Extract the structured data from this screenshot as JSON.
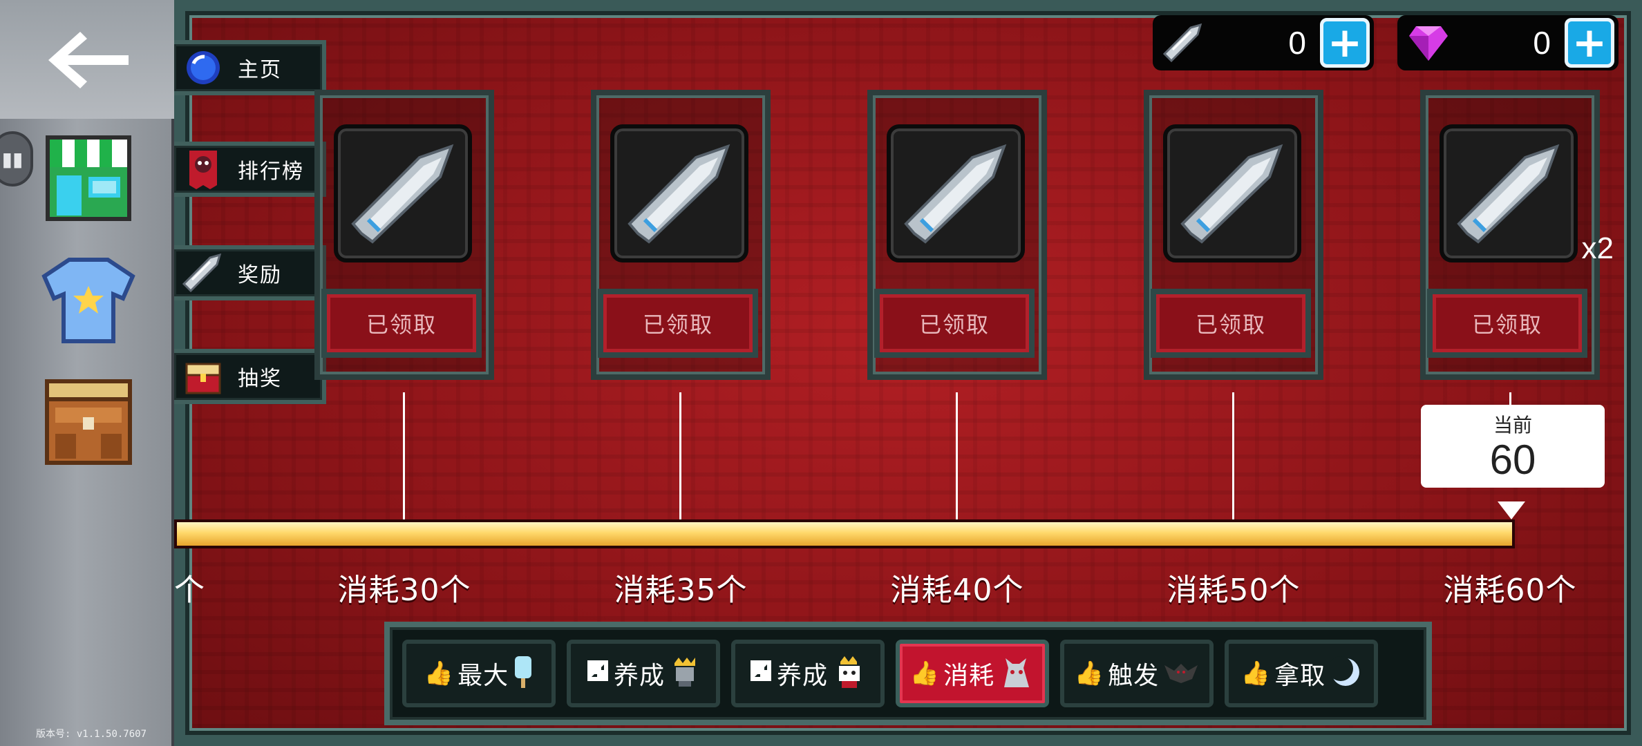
{
  "app": {
    "version_label": "版本号:",
    "version": "v1.1.50.7607"
  },
  "side_menu": [
    {
      "label": "主页",
      "icon": "blue-orb-icon"
    },
    {
      "label": "排行榜",
      "icon": "demon-banner-icon"
    },
    {
      "label": "奖励",
      "icon": "bullet-icon"
    },
    {
      "label": "抽奖",
      "icon": "treasure-chest-icon"
    }
  ],
  "sidebar": {
    "side_tab_glyph": "▮▮"
  },
  "currency": {
    "bullets": {
      "value": "0",
      "icon": "bullet-icon"
    },
    "gems": {
      "value": "0",
      "icon": "gem-icon"
    },
    "plus": "+"
  },
  "rewards": [
    {
      "milestone": "消耗30个",
      "status": "已领取",
      "qty": ""
    },
    {
      "milestone": "消耗35个",
      "status": "已领取",
      "qty": ""
    },
    {
      "milestone": "消耗40个",
      "status": "已领取",
      "qty": ""
    },
    {
      "milestone": "消耗50个",
      "status": "已领取",
      "qty": ""
    },
    {
      "milestone": "消耗60个",
      "status": "已领取",
      "qty": "x2"
    }
  ],
  "progress": {
    "current_title": "当前",
    "current_value": "60",
    "cut_prev_label": "个",
    "fill_fraction": 1.0
  },
  "tabs": [
    {
      "label": "最大",
      "icon": "thumb-up-icon",
      "pic": "popsicle-icon",
      "active": false
    },
    {
      "label": "养成",
      "icon": "expand-icon",
      "pic": "knight-icon",
      "active": false
    },
    {
      "label": "养成",
      "icon": "expand-icon",
      "pic": "cow-king-icon",
      "active": false
    },
    {
      "label": "消耗",
      "icon": "thumb-up-icon",
      "pic": "wolf-icon",
      "active": true
    },
    {
      "label": "触发",
      "icon": "thumb-up-icon",
      "pic": "bat-icon",
      "active": false
    },
    {
      "label": "拿取",
      "icon": "thumb-up-icon",
      "pic": "moon-icon",
      "active": false
    }
  ],
  "colors": {
    "accent_red": "#c2142e",
    "plus_blue": "#19a9e6",
    "progress_gold": "#ffd86b"
  }
}
